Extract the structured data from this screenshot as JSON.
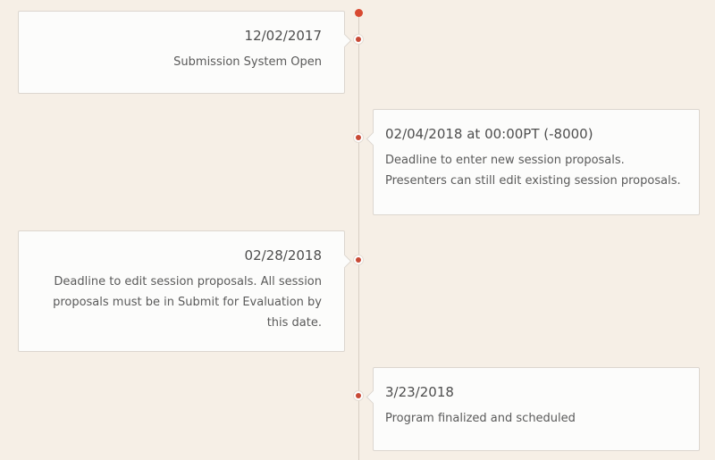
{
  "timeline": {
    "events": [
      {
        "date": "12/02/2017",
        "description": "Submission System Open"
      },
      {
        "date": "02/04/2018 at 00:00PT (-8000)",
        "description": "Deadline to enter new session proposals. Presenters can still edit existing session proposals."
      },
      {
        "date": "02/28/2018",
        "description": "Deadline to edit session proposals. All session proposals must be in Submit for Evaluation by this date."
      },
      {
        "date": "3/23/2018",
        "description": "Program finalized and scheduled"
      }
    ]
  },
  "colors": {
    "background": "#f6efe6",
    "accent": "#d84a32",
    "card": "#fcfcfb",
    "line": "#d8cfc4"
  }
}
